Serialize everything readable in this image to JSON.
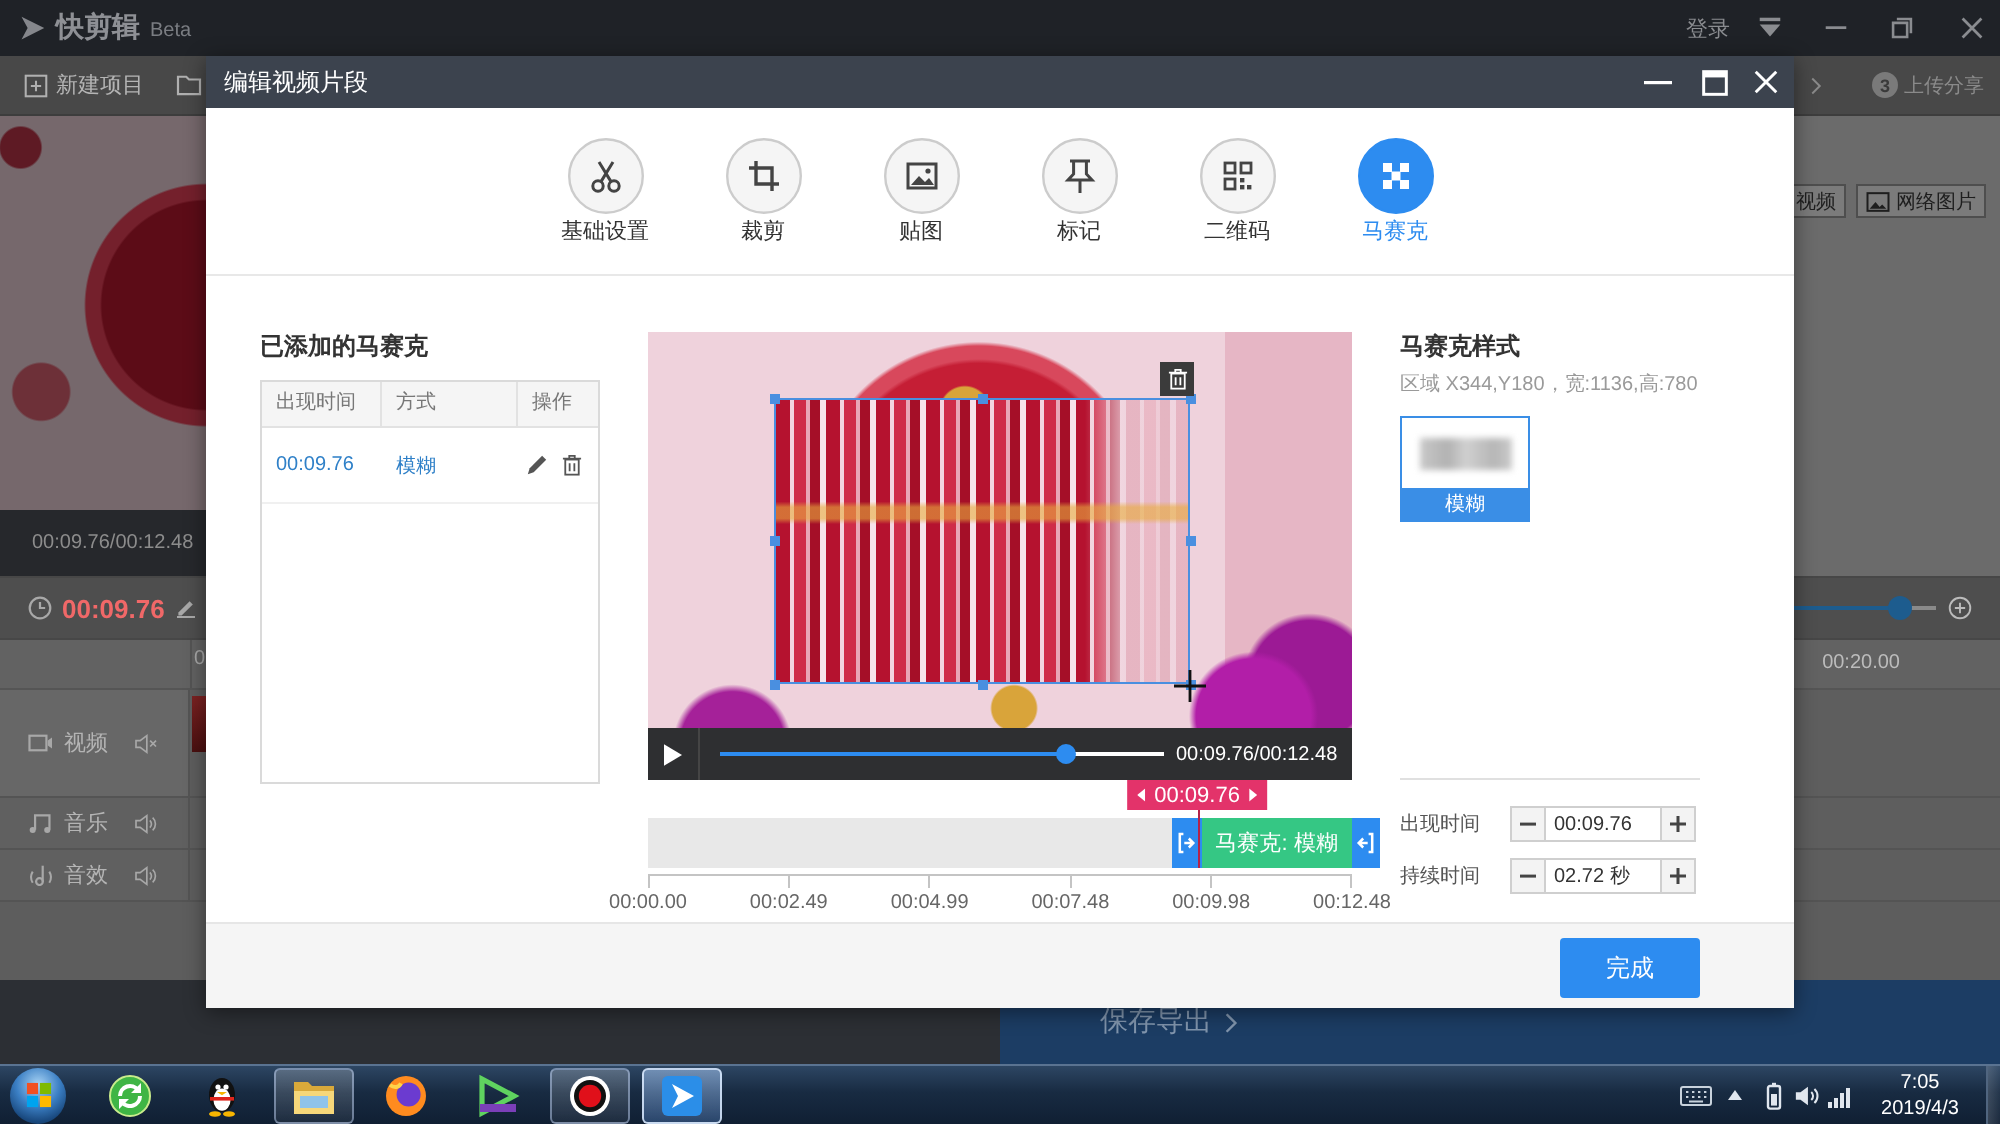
{
  "app": {
    "logo": "快剪辑",
    "badge": "Beta",
    "login": "登录",
    "toolbar": {
      "new_project": "新建项目",
      "step_number": "3",
      "step_label": "上传分享"
    },
    "preview_time": "00:09.76/00:12.48",
    "media_buttons": [
      {
        "label": "视频",
        "icon": false
      },
      {
        "label": "网络图片",
        "icon": true
      }
    ],
    "current_time": "00:09.76",
    "zoom_slider": {
      "level": 0.75
    },
    "ruler_labels": [
      "0",
      "00:20.00"
    ],
    "tracks": [
      {
        "label": "视频",
        "kind": "video",
        "muted": true
      },
      {
        "label": "音乐",
        "kind": "music",
        "muted": false
      },
      {
        "label": "音效",
        "kind": "effect",
        "muted": false
      }
    ],
    "save_button": "保存导出"
  },
  "dialog": {
    "title": "编辑视频片段",
    "tools": [
      {
        "label": "基础设置",
        "kind": "scissors",
        "selected": false
      },
      {
        "label": "裁剪",
        "kind": "crop",
        "selected": false
      },
      {
        "label": "贴图",
        "kind": "image",
        "selected": false
      },
      {
        "label": "标记",
        "kind": "pin",
        "selected": false
      },
      {
        "label": "二维码",
        "kind": "qrcode",
        "selected": false
      },
      {
        "label": "马赛克",
        "kind": "mosaic",
        "selected": true
      }
    ],
    "added_list": {
      "title": "已添加的马赛克",
      "columns": [
        "出现时间",
        "方式",
        "操作"
      ],
      "rows": [
        {
          "time": "00:09.76",
          "mode": "模糊"
        }
      ]
    },
    "player": {
      "time": "00:09.76/00:12.48",
      "level": 0.78
    },
    "clip_timeline": {
      "marker": "00:09.76",
      "segment": "马赛克: 模糊",
      "ticks": [
        "00:00.00",
        "00:02.49",
        "00:04.99",
        "00:07.48",
        "00:09.98",
        "00:12.48"
      ]
    },
    "style_panel": {
      "title": "马赛克样式",
      "region": "区域 X344,Y180，宽:1136,高:780",
      "styles": [
        {
          "label": "模糊",
          "selected": true
        }
      ]
    },
    "timing": [
      {
        "label": "出现时间",
        "value": "00:09.76"
      },
      {
        "label": "持续时间",
        "value": "02.72 秒"
      }
    ],
    "done_button": "完成"
  },
  "taskbar": {
    "apps": [
      {
        "kind": "swirl",
        "running": false,
        "selected": false
      },
      {
        "kind": "penguin",
        "running": false,
        "selected": false
      },
      {
        "kind": "folder",
        "running": true,
        "selected": false
      },
      {
        "kind": "firefox",
        "running": false,
        "selected": false
      },
      {
        "kind": "bolt",
        "running": false,
        "selected": false
      },
      {
        "kind": "record",
        "running": true,
        "selected": false
      },
      {
        "kind": "player",
        "running": true,
        "selected": true
      }
    ],
    "time": "7:05",
    "date": "2019/4/3"
  }
}
